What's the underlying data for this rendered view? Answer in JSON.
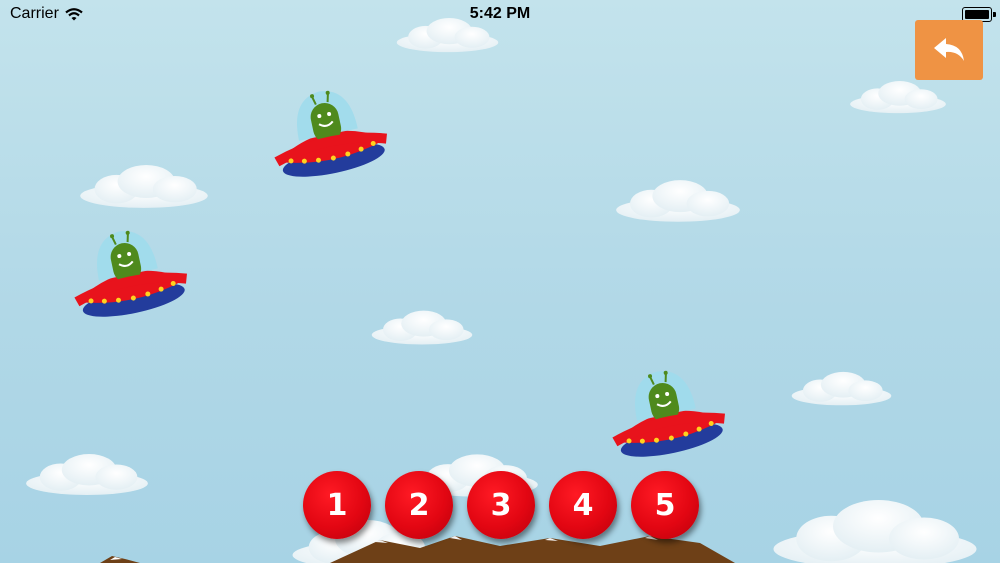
{
  "status_bar": {
    "carrier": "Carrier",
    "time": "5:42 PM"
  },
  "toolbar": {
    "back_icon": "undo-arrow-icon",
    "back_color": "#ef9344"
  },
  "answer_buttons": [
    {
      "label": "1"
    },
    {
      "label": "2"
    },
    {
      "label": "3"
    },
    {
      "label": "4"
    },
    {
      "label": "5"
    }
  ],
  "colors": {
    "button_red": "#e20612",
    "sky": "#b8dce8",
    "ufo_red": "#e8131c",
    "alien_green": "#4f8a1d"
  },
  "scene": {
    "ufo_count": 3
  }
}
